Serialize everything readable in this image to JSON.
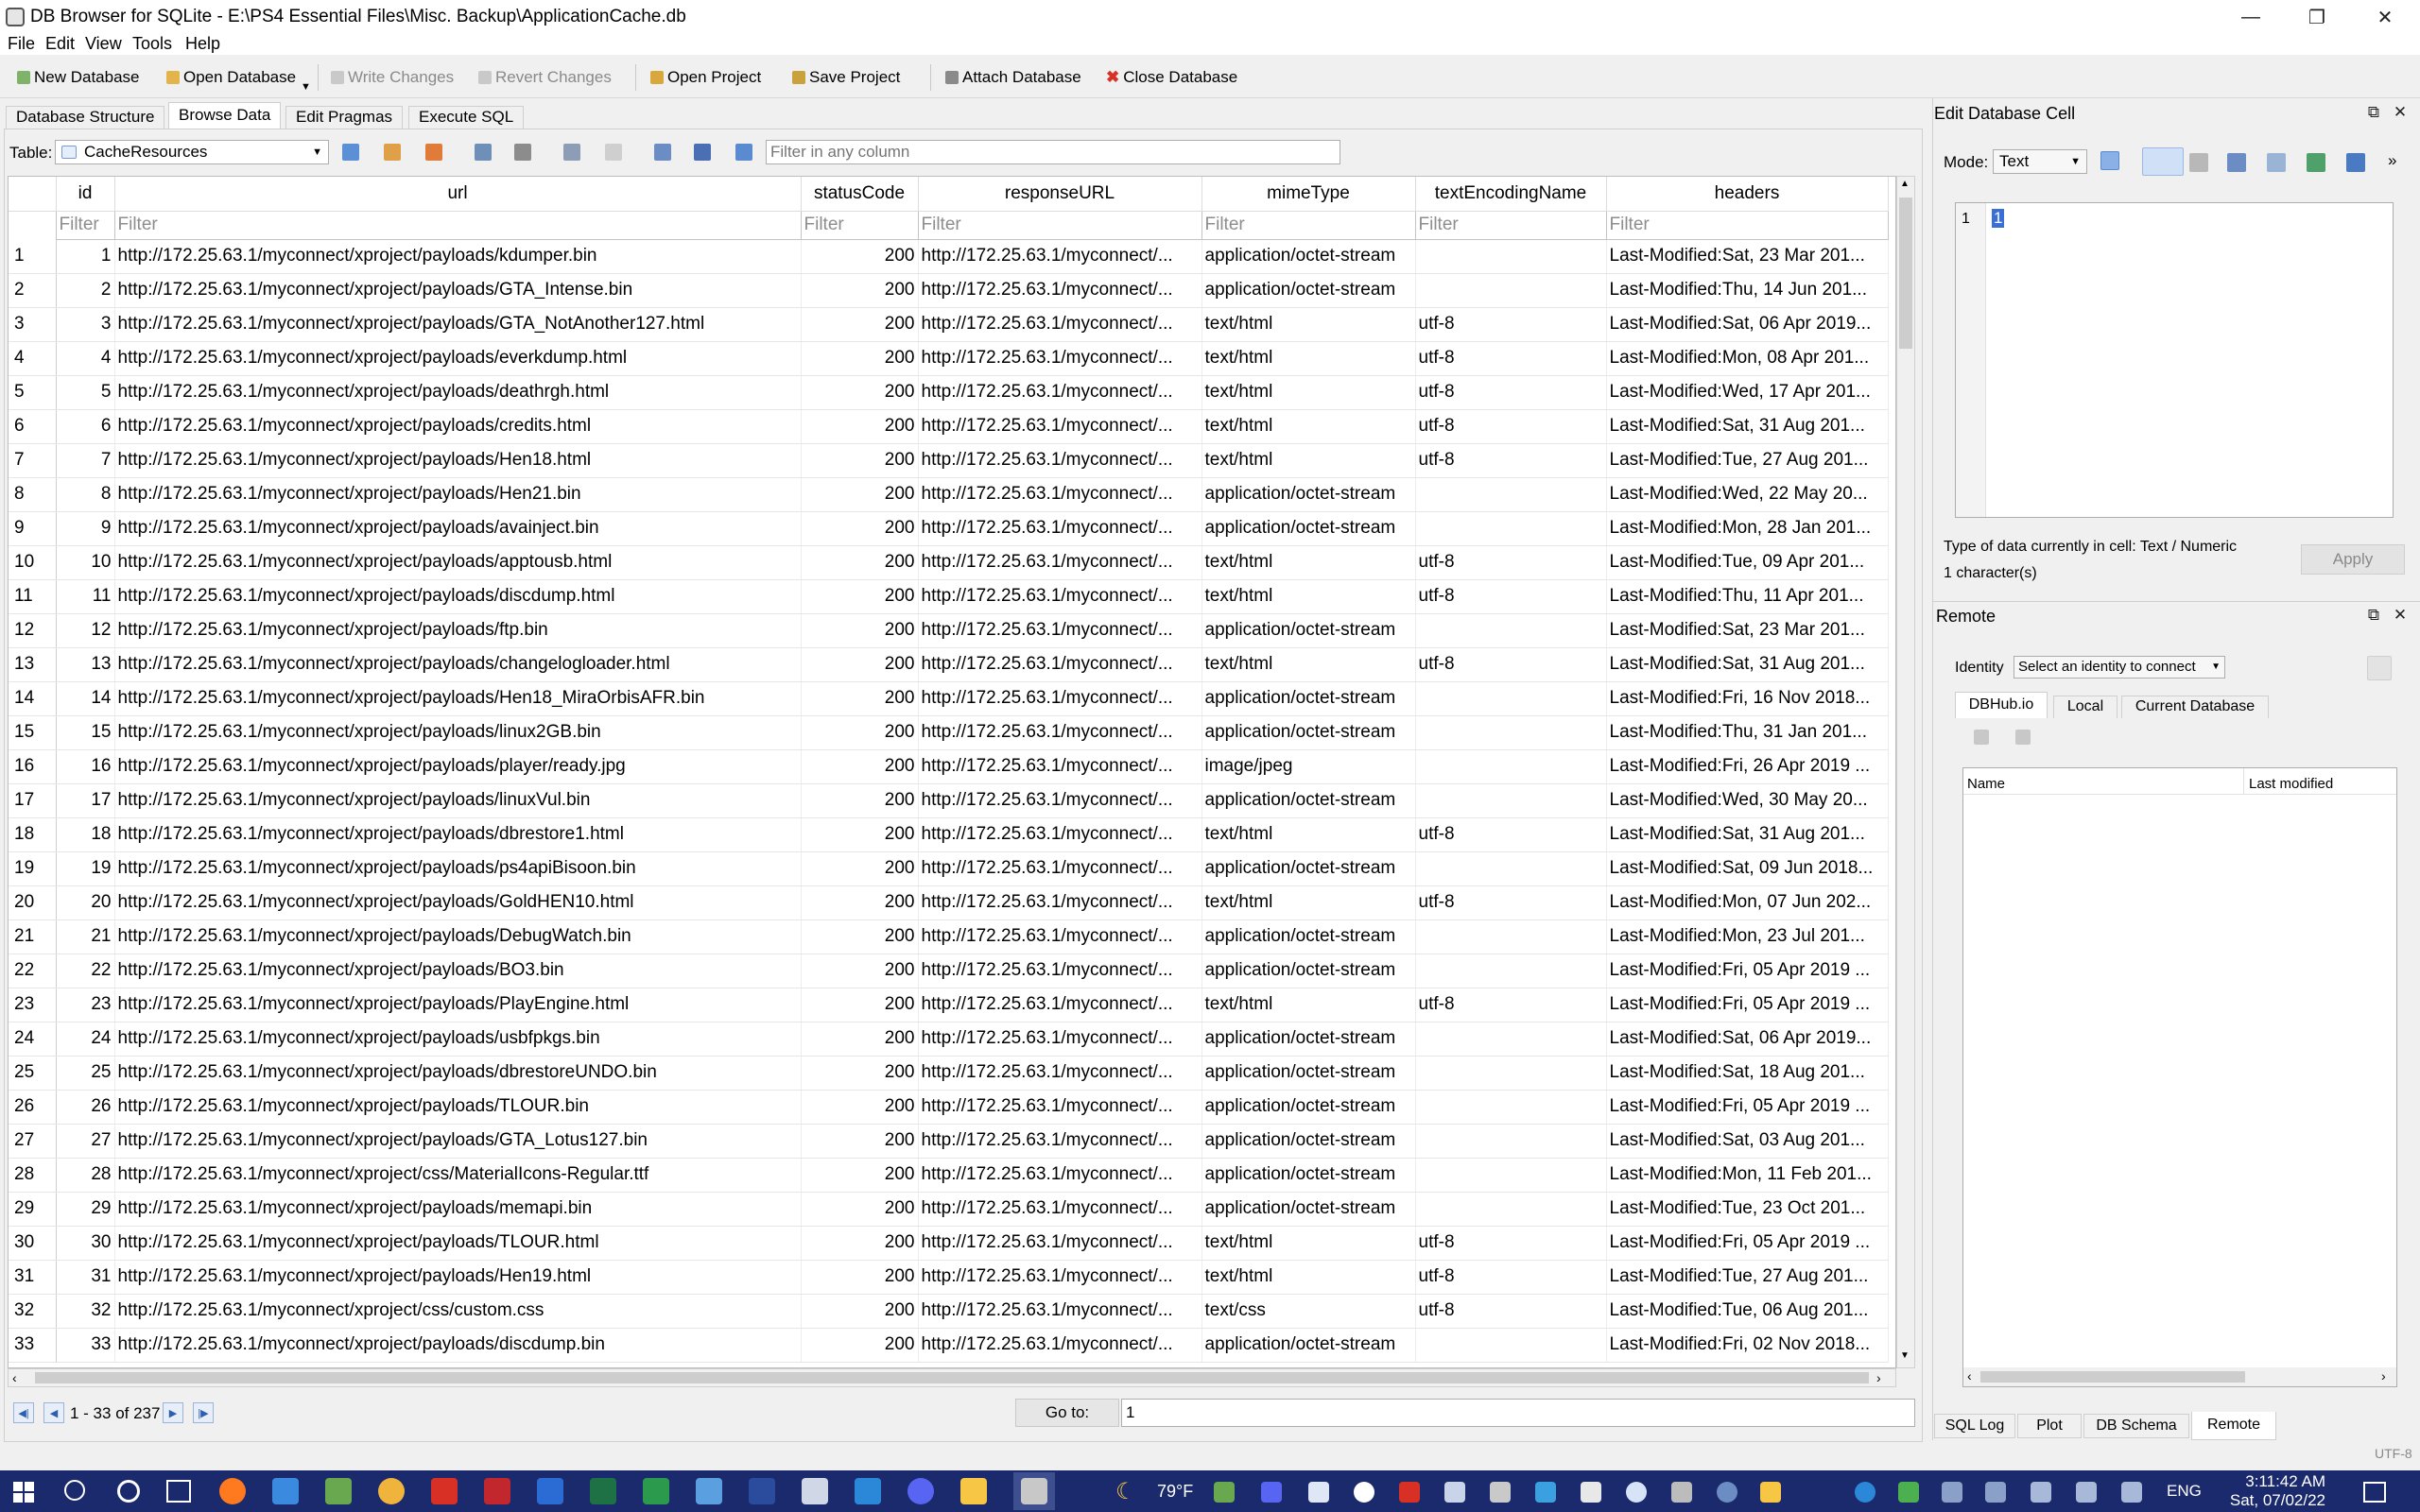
{
  "window": {
    "title": "DB Browser for SQLite - E:\\PS4 Essential Files\\Misc. Backup\\ApplicationCache.db",
    "minimize_icon": "minimize-icon",
    "restore_icon": "restore-icon",
    "close_icon": "close-icon"
  },
  "menu": [
    "File",
    "Edit",
    "View",
    "Tools",
    "Help"
  ],
  "toolbar": {
    "new_database": "New Database",
    "open_database": "Open Database",
    "write_changes": "Write Changes",
    "revert_changes": "Revert Changes",
    "open_project": "Open Project",
    "save_project": "Save Project",
    "attach_database": "Attach Database",
    "close_database": "Close Database"
  },
  "tabs": [
    "Database Structure",
    "Browse Data",
    "Edit Pragmas",
    "Execute SQL"
  ],
  "browse": {
    "table_label": "Table:",
    "table_value": "CacheResources",
    "filter_placeholder": "Filter in any column",
    "columns": [
      "id",
      "url",
      "statusCode",
      "responseURL",
      "mimeType",
      "textEncodingName",
      "headers"
    ],
    "filter_text": "Filter",
    "rows": [
      [
        "1",
        "http://172.25.63.1/myconnect/xproject/payloads/kdumper.bin",
        "200",
        "http://172.25.63.1/myconnect/...",
        "application/octet-stream",
        "",
        "Last-Modified:Sat, 23 Mar 201..."
      ],
      [
        "2",
        "http://172.25.63.1/myconnect/xproject/payloads/GTA_Intense.bin",
        "200",
        "http://172.25.63.1/myconnect/...",
        "application/octet-stream",
        "",
        "Last-Modified:Thu, 14 Jun 201..."
      ],
      [
        "3",
        "http://172.25.63.1/myconnect/xproject/payloads/GTA_NotAnother127.html",
        "200",
        "http://172.25.63.1/myconnect/...",
        "text/html",
        "utf-8",
        "Last-Modified:Sat, 06 Apr 2019..."
      ],
      [
        "4",
        "http://172.25.63.1/myconnect/xproject/payloads/everkdump.html",
        "200",
        "http://172.25.63.1/myconnect/...",
        "text/html",
        "utf-8",
        "Last-Modified:Mon, 08 Apr 201..."
      ],
      [
        "5",
        "http://172.25.63.1/myconnect/xproject/payloads/deathrgh.html",
        "200",
        "http://172.25.63.1/myconnect/...",
        "text/html",
        "utf-8",
        "Last-Modified:Wed, 17 Apr 201..."
      ],
      [
        "6",
        "http://172.25.63.1/myconnect/xproject/payloads/credits.html",
        "200",
        "http://172.25.63.1/myconnect/...",
        "text/html",
        "utf-8",
        "Last-Modified:Sat, 31 Aug 201..."
      ],
      [
        "7",
        "http://172.25.63.1/myconnect/xproject/payloads/Hen18.html",
        "200",
        "http://172.25.63.1/myconnect/...",
        "text/html",
        "utf-8",
        "Last-Modified:Tue, 27 Aug 201..."
      ],
      [
        "8",
        "http://172.25.63.1/myconnect/xproject/payloads/Hen21.bin",
        "200",
        "http://172.25.63.1/myconnect/...",
        "application/octet-stream",
        "",
        "Last-Modified:Wed, 22 May 20..."
      ],
      [
        "9",
        "http://172.25.63.1/myconnect/xproject/payloads/avainject.bin",
        "200",
        "http://172.25.63.1/myconnect/...",
        "application/octet-stream",
        "",
        "Last-Modified:Mon, 28 Jan 201..."
      ],
      [
        "10",
        "http://172.25.63.1/myconnect/xproject/payloads/apptousb.html",
        "200",
        "http://172.25.63.1/myconnect/...",
        "text/html",
        "utf-8",
        "Last-Modified:Tue, 09 Apr 201..."
      ],
      [
        "11",
        "http://172.25.63.1/myconnect/xproject/payloads/discdump.html",
        "200",
        "http://172.25.63.1/myconnect/...",
        "text/html",
        "utf-8",
        "Last-Modified:Thu, 11 Apr 201..."
      ],
      [
        "12",
        "http://172.25.63.1/myconnect/xproject/payloads/ftp.bin",
        "200",
        "http://172.25.63.1/myconnect/...",
        "application/octet-stream",
        "",
        "Last-Modified:Sat, 23 Mar 201..."
      ],
      [
        "13",
        "http://172.25.63.1/myconnect/xproject/payloads/changelogloader.html",
        "200",
        "http://172.25.63.1/myconnect/...",
        "text/html",
        "utf-8",
        "Last-Modified:Sat, 31 Aug 201..."
      ],
      [
        "14",
        "http://172.25.63.1/myconnect/xproject/payloads/Hen18_MiraOrbisAFR.bin",
        "200",
        "http://172.25.63.1/myconnect/...",
        "application/octet-stream",
        "",
        "Last-Modified:Fri, 16 Nov 2018..."
      ],
      [
        "15",
        "http://172.25.63.1/myconnect/xproject/payloads/linux2GB.bin",
        "200",
        "http://172.25.63.1/myconnect/...",
        "application/octet-stream",
        "",
        "Last-Modified:Thu, 31 Jan 201..."
      ],
      [
        "16",
        "http://172.25.63.1/myconnect/xproject/payloads/player/ready.jpg",
        "200",
        "http://172.25.63.1/myconnect/...",
        "image/jpeg",
        "",
        "Last-Modified:Fri, 26 Apr 2019 ..."
      ],
      [
        "17",
        "http://172.25.63.1/myconnect/xproject/payloads/linuxVul.bin",
        "200",
        "http://172.25.63.1/myconnect/...",
        "application/octet-stream",
        "",
        "Last-Modified:Wed, 30 May 20..."
      ],
      [
        "18",
        "http://172.25.63.1/myconnect/xproject/payloads/dbrestore1.html",
        "200",
        "http://172.25.63.1/myconnect/...",
        "text/html",
        "utf-8",
        "Last-Modified:Sat, 31 Aug 201..."
      ],
      [
        "19",
        "http://172.25.63.1/myconnect/xproject/payloads/ps4apiBisoon.bin",
        "200",
        "http://172.25.63.1/myconnect/...",
        "application/octet-stream",
        "",
        "Last-Modified:Sat, 09 Jun 2018..."
      ],
      [
        "20",
        "http://172.25.63.1/myconnect/xproject/payloads/GoldHEN10.html",
        "200",
        "http://172.25.63.1/myconnect/...",
        "text/html",
        "utf-8",
        "Last-Modified:Mon, 07 Jun 202..."
      ],
      [
        "21",
        "http://172.25.63.1/myconnect/xproject/payloads/DebugWatch.bin",
        "200",
        "http://172.25.63.1/myconnect/...",
        "application/octet-stream",
        "",
        "Last-Modified:Mon, 23 Jul 201..."
      ],
      [
        "22",
        "http://172.25.63.1/myconnect/xproject/payloads/BO3.bin",
        "200",
        "http://172.25.63.1/myconnect/...",
        "application/octet-stream",
        "",
        "Last-Modified:Fri, 05 Apr 2019 ..."
      ],
      [
        "23",
        "http://172.25.63.1/myconnect/xproject/payloads/PlayEngine.html",
        "200",
        "http://172.25.63.1/myconnect/...",
        "text/html",
        "utf-8",
        "Last-Modified:Fri, 05 Apr 2019 ..."
      ],
      [
        "24",
        "http://172.25.63.1/myconnect/xproject/payloads/usbfpkgs.bin",
        "200",
        "http://172.25.63.1/myconnect/...",
        "application/octet-stream",
        "",
        "Last-Modified:Sat, 06 Apr 2019..."
      ],
      [
        "25",
        "http://172.25.63.1/myconnect/xproject/payloads/dbrestoreUNDO.bin",
        "200",
        "http://172.25.63.1/myconnect/...",
        "application/octet-stream",
        "",
        "Last-Modified:Sat, 18 Aug 201..."
      ],
      [
        "26",
        "http://172.25.63.1/myconnect/xproject/payloads/TLOUR.bin",
        "200",
        "http://172.25.63.1/myconnect/...",
        "application/octet-stream",
        "",
        "Last-Modified:Fri, 05 Apr 2019 ..."
      ],
      [
        "27",
        "http://172.25.63.1/myconnect/xproject/payloads/GTA_Lotus127.bin",
        "200",
        "http://172.25.63.1/myconnect/...",
        "application/octet-stream",
        "",
        "Last-Modified:Sat, 03 Aug 201..."
      ],
      [
        "28",
        "http://172.25.63.1/myconnect/xproject/css/MaterialIcons-Regular.ttf",
        "200",
        "http://172.25.63.1/myconnect/...",
        "application/octet-stream",
        "",
        "Last-Modified:Mon, 11 Feb 201..."
      ],
      [
        "29",
        "http://172.25.63.1/myconnect/xproject/payloads/memapi.bin",
        "200",
        "http://172.25.63.1/myconnect/...",
        "application/octet-stream",
        "",
        "Last-Modified:Tue, 23 Oct 201..."
      ],
      [
        "30",
        "http://172.25.63.1/myconnect/xproject/payloads/TLOUR.html",
        "200",
        "http://172.25.63.1/myconnect/...",
        "text/html",
        "utf-8",
        "Last-Modified:Fri, 05 Apr 2019 ..."
      ],
      [
        "31",
        "http://172.25.63.1/myconnect/xproject/payloads/Hen19.html",
        "200",
        "http://172.25.63.1/myconnect/...",
        "text/html",
        "utf-8",
        "Last-Modified:Tue, 27 Aug 201..."
      ],
      [
        "32",
        "http://172.25.63.1/myconnect/xproject/css/custom.css",
        "200",
        "http://172.25.63.1/myconnect/...",
        "text/css",
        "utf-8",
        "Last-Modified:Tue, 06 Aug 201..."
      ],
      [
        "33",
        "http://172.25.63.1/myconnect/xproject/payloads/discdump.bin",
        "200",
        "http://172.25.63.1/myconnect/...",
        "application/octet-stream",
        "",
        "Last-Modified:Fri, 02 Nov 2018..."
      ]
    ],
    "record_range": "1 - 33 of 237",
    "goto_label": "Go to:",
    "goto_value": "1"
  },
  "edit_cell": {
    "title": "Edit Database Cell",
    "mode_label": "Mode:",
    "mode_value": "Text",
    "line_number": "1",
    "cell_value": "1",
    "type_info": "Type of data currently in cell: Text / Numeric",
    "size_info": "1 character(s)",
    "apply": "Apply"
  },
  "remote": {
    "title": "Remote",
    "identity_label": "Identity",
    "identity_value": "Select an identity to connect",
    "tabs": [
      "DBHub.io",
      "Local",
      "Current Database"
    ],
    "col_name": "Name",
    "col_modified": "Last modified"
  },
  "bottom_tabs": [
    "SQL Log",
    "Plot",
    "DB Schema",
    "Remote"
  ],
  "encoding": "UTF-8",
  "taskbar": {
    "weather": "79°F",
    "language": "ENG",
    "time": "3:11:42 AM",
    "date": "Sat, 07/02/22"
  },
  "colors": {
    "accent": "#3a6fd8",
    "taskbar": "#1a2a6c",
    "close_red": "#d93025"
  }
}
